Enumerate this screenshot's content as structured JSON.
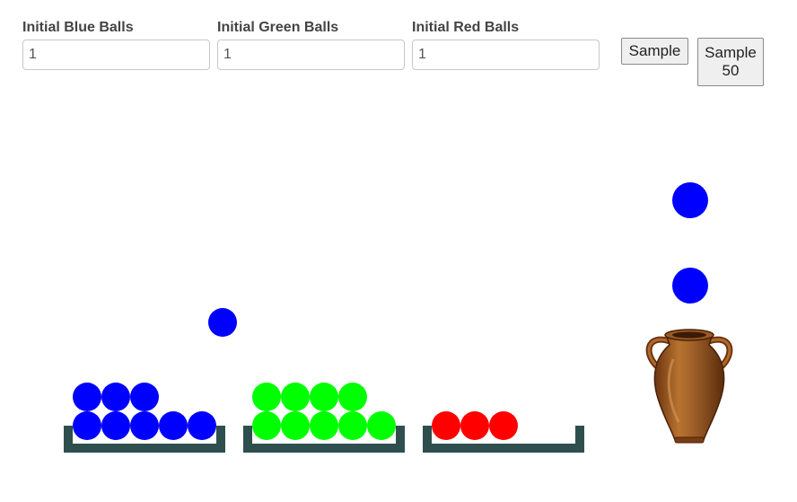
{
  "inputs": {
    "blue": {
      "label": "Initial Blue Balls",
      "value": "1"
    },
    "green": {
      "label": "Initial Green Balls",
      "value": "1"
    },
    "red": {
      "label": "Initial Red Balls",
      "value": "1"
    }
  },
  "buttons": {
    "sample": "Sample",
    "sample50": "Sample 50"
  },
  "colors": {
    "blue": "#0000ff",
    "green": "#00ff00",
    "red": "#ff0000",
    "bin": "#2f4f4f",
    "urn": "#8b4513"
  },
  "bins": [
    {
      "color": "blue",
      "count": 8
    },
    {
      "color": "green",
      "count": 9
    },
    {
      "color": "red",
      "count": 3
    }
  ],
  "falling_balls": [
    {
      "color": "blue"
    },
    {
      "color": "blue"
    },
    {
      "color": "blue"
    }
  ],
  "urn": {
    "icon": "amphora-urn-icon"
  }
}
